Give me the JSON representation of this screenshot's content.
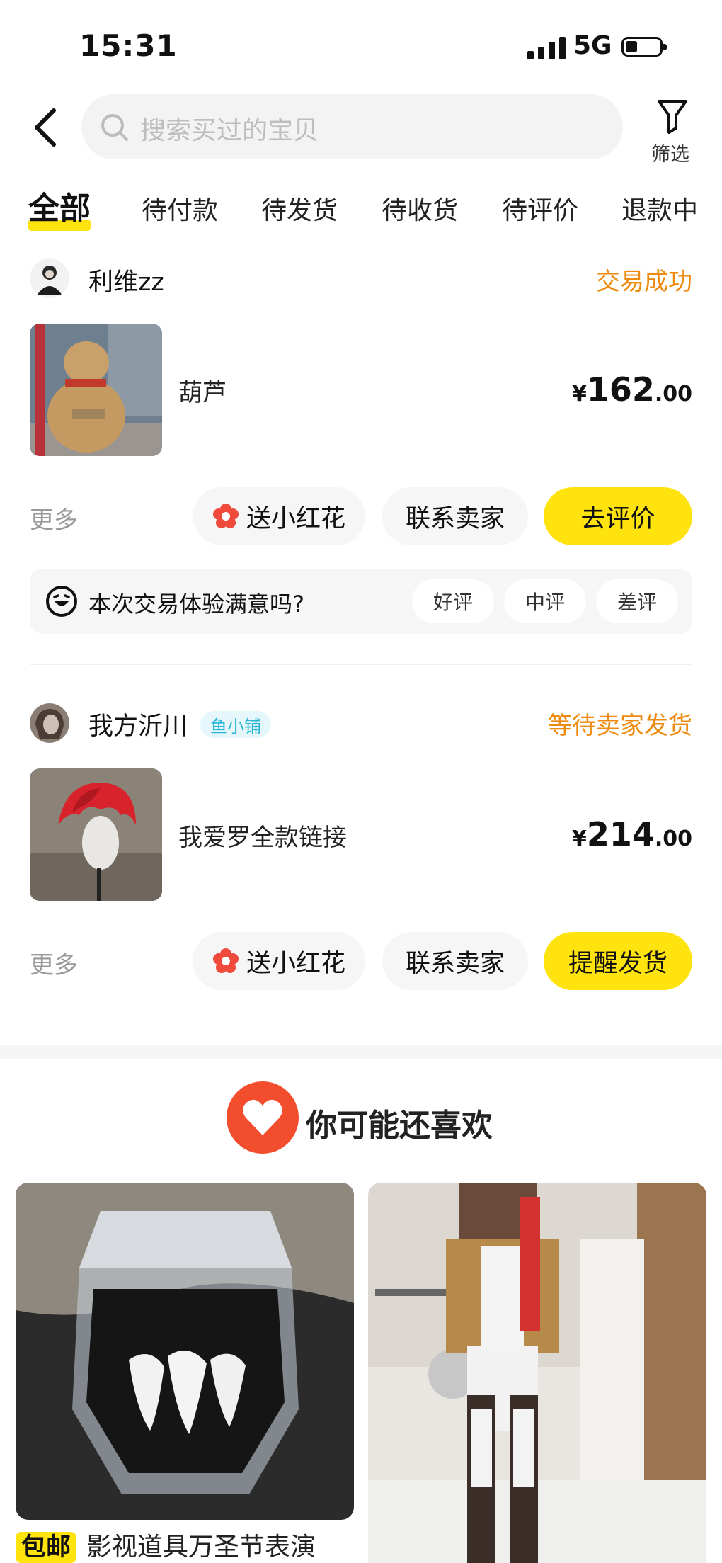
{
  "status_bar": {
    "time": "15:31",
    "network": "5G"
  },
  "header": {
    "search_placeholder": "搜索买过的宝贝",
    "filter_label": "筛选"
  },
  "tabs": [
    "全部",
    "待付款",
    "待发货",
    "待收货",
    "待评价",
    "退款中"
  ],
  "active_tab": "全部",
  "orders": [
    {
      "seller": "利维zz",
      "status": "交易成功",
      "item_title": "葫芦",
      "price_symbol": "¥",
      "price_int": "162",
      "price_dec": ".00",
      "more": "更多",
      "btn_flower": "送小红花",
      "btn_contact": "联系卖家",
      "btn_primary": "去评价",
      "rating_question": "本次交易体验满意吗?",
      "rating_options": [
        "好评",
        "中评",
        "差评"
      ]
    },
    {
      "seller": "我方沂川",
      "shop_tag": "鱼小铺",
      "status": "等待卖家发货",
      "item_title": "我爱罗全款链接",
      "price_symbol": "¥",
      "price_int": "214",
      "price_dec": ".00",
      "more": "更多",
      "btn_flower": "送小红花",
      "btn_contact": "联系卖家",
      "btn_primary": "提醒发货"
    }
  ],
  "recommend": {
    "title": "你可能还喜欢",
    "cards": [
      {
        "badge": "包邮",
        "title": "影视道具万圣节表演"
      },
      {
        "title": ""
      }
    ]
  },
  "colors": {
    "accent_yellow": "#ffe30f",
    "status_orange": "#ee8a0e",
    "shop_tag_blue": "#27b5d6",
    "heart_red": "#f24d2c"
  },
  "icons": [
    "back-arrow-icon",
    "search-icon",
    "filter-icon",
    "flower-icon",
    "smile-icon",
    "heart-icon"
  ]
}
